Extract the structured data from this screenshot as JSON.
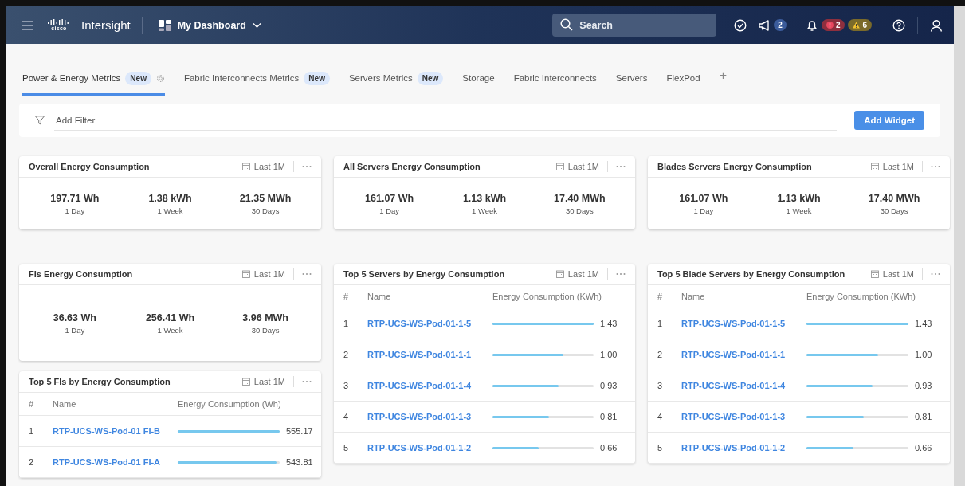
{
  "header": {
    "logo": "cisco",
    "product": "Intersight",
    "dashboard": "My Dashboard",
    "search": {
      "placeholder": "Search"
    },
    "announcements_count": "2",
    "alerts": [
      {
        "kind": "critical",
        "count": "2"
      },
      {
        "kind": "warning",
        "count": "6"
      }
    ]
  },
  "tabs": [
    {
      "label": "Power & Energy Metrics",
      "badge": "New",
      "selected": true,
      "settings": true
    },
    {
      "label": "Fabric Interconnects Metrics",
      "badge": "New",
      "selected": false,
      "settings": false
    },
    {
      "label": "Servers Metrics",
      "badge": "New",
      "selected": false,
      "settings": false
    },
    {
      "label": "Storage",
      "selected": false,
      "settings": false
    },
    {
      "label": "Fabric Interconnects",
      "selected": false,
      "settings": false
    },
    {
      "label": "Servers",
      "selected": false,
      "settings": false
    },
    {
      "label": "FlexPod",
      "selected": false,
      "settings": false
    }
  ],
  "add_tab": "+",
  "filter": {
    "placeholder": "Add Filter"
  },
  "add_widget": "Add Widget",
  "columns": [
    [
      {
        "kind": "summary",
        "title": "Overall Energy Consumption",
        "range": "Last 1M",
        "metrics": [
          {
            "value": "197.71 Wh",
            "label": "1 Day"
          },
          {
            "value": "1.38 kWh",
            "label": "1 Week"
          },
          {
            "value": "21.35 MWh",
            "label": "30 Days"
          }
        ]
      },
      {
        "kind": "summary",
        "title": "FIs Energy Consumption",
        "range": "Last 1M",
        "metrics": [
          {
            "value": "36.63 Wh",
            "label": "1 Day"
          },
          {
            "value": "256.41 Wh",
            "label": "1 Week"
          },
          {
            "value": "3.96 MWh",
            "label": "30 Days"
          }
        ]
      },
      {
        "kind": "table",
        "title": "Top 5 FIs by Energy Consumption",
        "range": "Last 1M",
        "columns": [
          "#",
          "Name",
          "Energy Consumption (Wh)"
        ],
        "rows": [
          {
            "index": "1",
            "name": "RTP-UCS-WS-Pod-01 FI-B",
            "level": 1.0,
            "value": "555.17"
          },
          {
            "index": "2",
            "name": "RTP-UCS-WS-Pod-01 FI-A",
            "level": 0.97,
            "value": "543.81"
          }
        ]
      }
    ],
    [
      {
        "kind": "summary",
        "title": "All Servers Energy Consumption",
        "range": "Last 1M",
        "metrics": [
          {
            "value": "161.07 Wh",
            "label": "1 Day"
          },
          {
            "value": "1.13 kWh",
            "label": "1 Week"
          },
          {
            "value": "17.40 MWh",
            "label": "30 Days"
          }
        ]
      },
      {
        "kind": "table",
        "title": "Top 5 Servers by Energy Consumption",
        "range": "Last 1M",
        "columns": [
          "#",
          "Name",
          "Energy Consumption (KWh)"
        ],
        "rows": [
          {
            "index": "1",
            "name": "RTP-UCS-WS-Pod-01-1-5",
            "level": 1.0,
            "value": "1.43"
          },
          {
            "index": "2",
            "name": "RTP-UCS-WS-Pod-01-1-1",
            "level": 0.7,
            "value": "1.00"
          },
          {
            "index": "3",
            "name": "RTP-UCS-WS-Pod-01-1-4",
            "level": 0.65,
            "value": "0.93"
          },
          {
            "index": "4",
            "name": "RTP-UCS-WS-Pod-01-1-3",
            "level": 0.56,
            "value": "0.81"
          },
          {
            "index": "5",
            "name": "RTP-UCS-WS-Pod-01-1-2",
            "level": 0.46,
            "value": "0.66"
          }
        ]
      }
    ],
    [
      {
        "kind": "summary",
        "title": "Blades Servers Energy Consumption",
        "range": "Last 1M",
        "metrics": [
          {
            "value": "161.07 Wh",
            "label": "1 Day"
          },
          {
            "value": "1.13 kWh",
            "label": "1 Week"
          },
          {
            "value": "17.40 MWh",
            "label": "30 Days"
          }
        ]
      },
      {
        "kind": "table",
        "title": "Top 5 Blade Servers by Energy Consumption",
        "range": "Last 1M",
        "columns": [
          "#",
          "Name",
          "Energy Consumption (KWh)"
        ],
        "rows": [
          {
            "index": "1",
            "name": "RTP-UCS-WS-Pod-01-1-5",
            "level": 1.0,
            "value": "1.43"
          },
          {
            "index": "2",
            "name": "RTP-UCS-WS-Pod-01-1-1",
            "level": 0.7,
            "value": "1.00"
          },
          {
            "index": "3",
            "name": "RTP-UCS-WS-Pod-01-1-4",
            "level": 0.65,
            "value": "0.93"
          },
          {
            "index": "4",
            "name": "RTP-UCS-WS-Pod-01-1-3",
            "level": 0.56,
            "value": "0.81"
          },
          {
            "index": "5",
            "name": "RTP-UCS-WS-Pod-01-1-2",
            "level": 0.46,
            "value": "0.66"
          }
        ]
      }
    ]
  ]
}
